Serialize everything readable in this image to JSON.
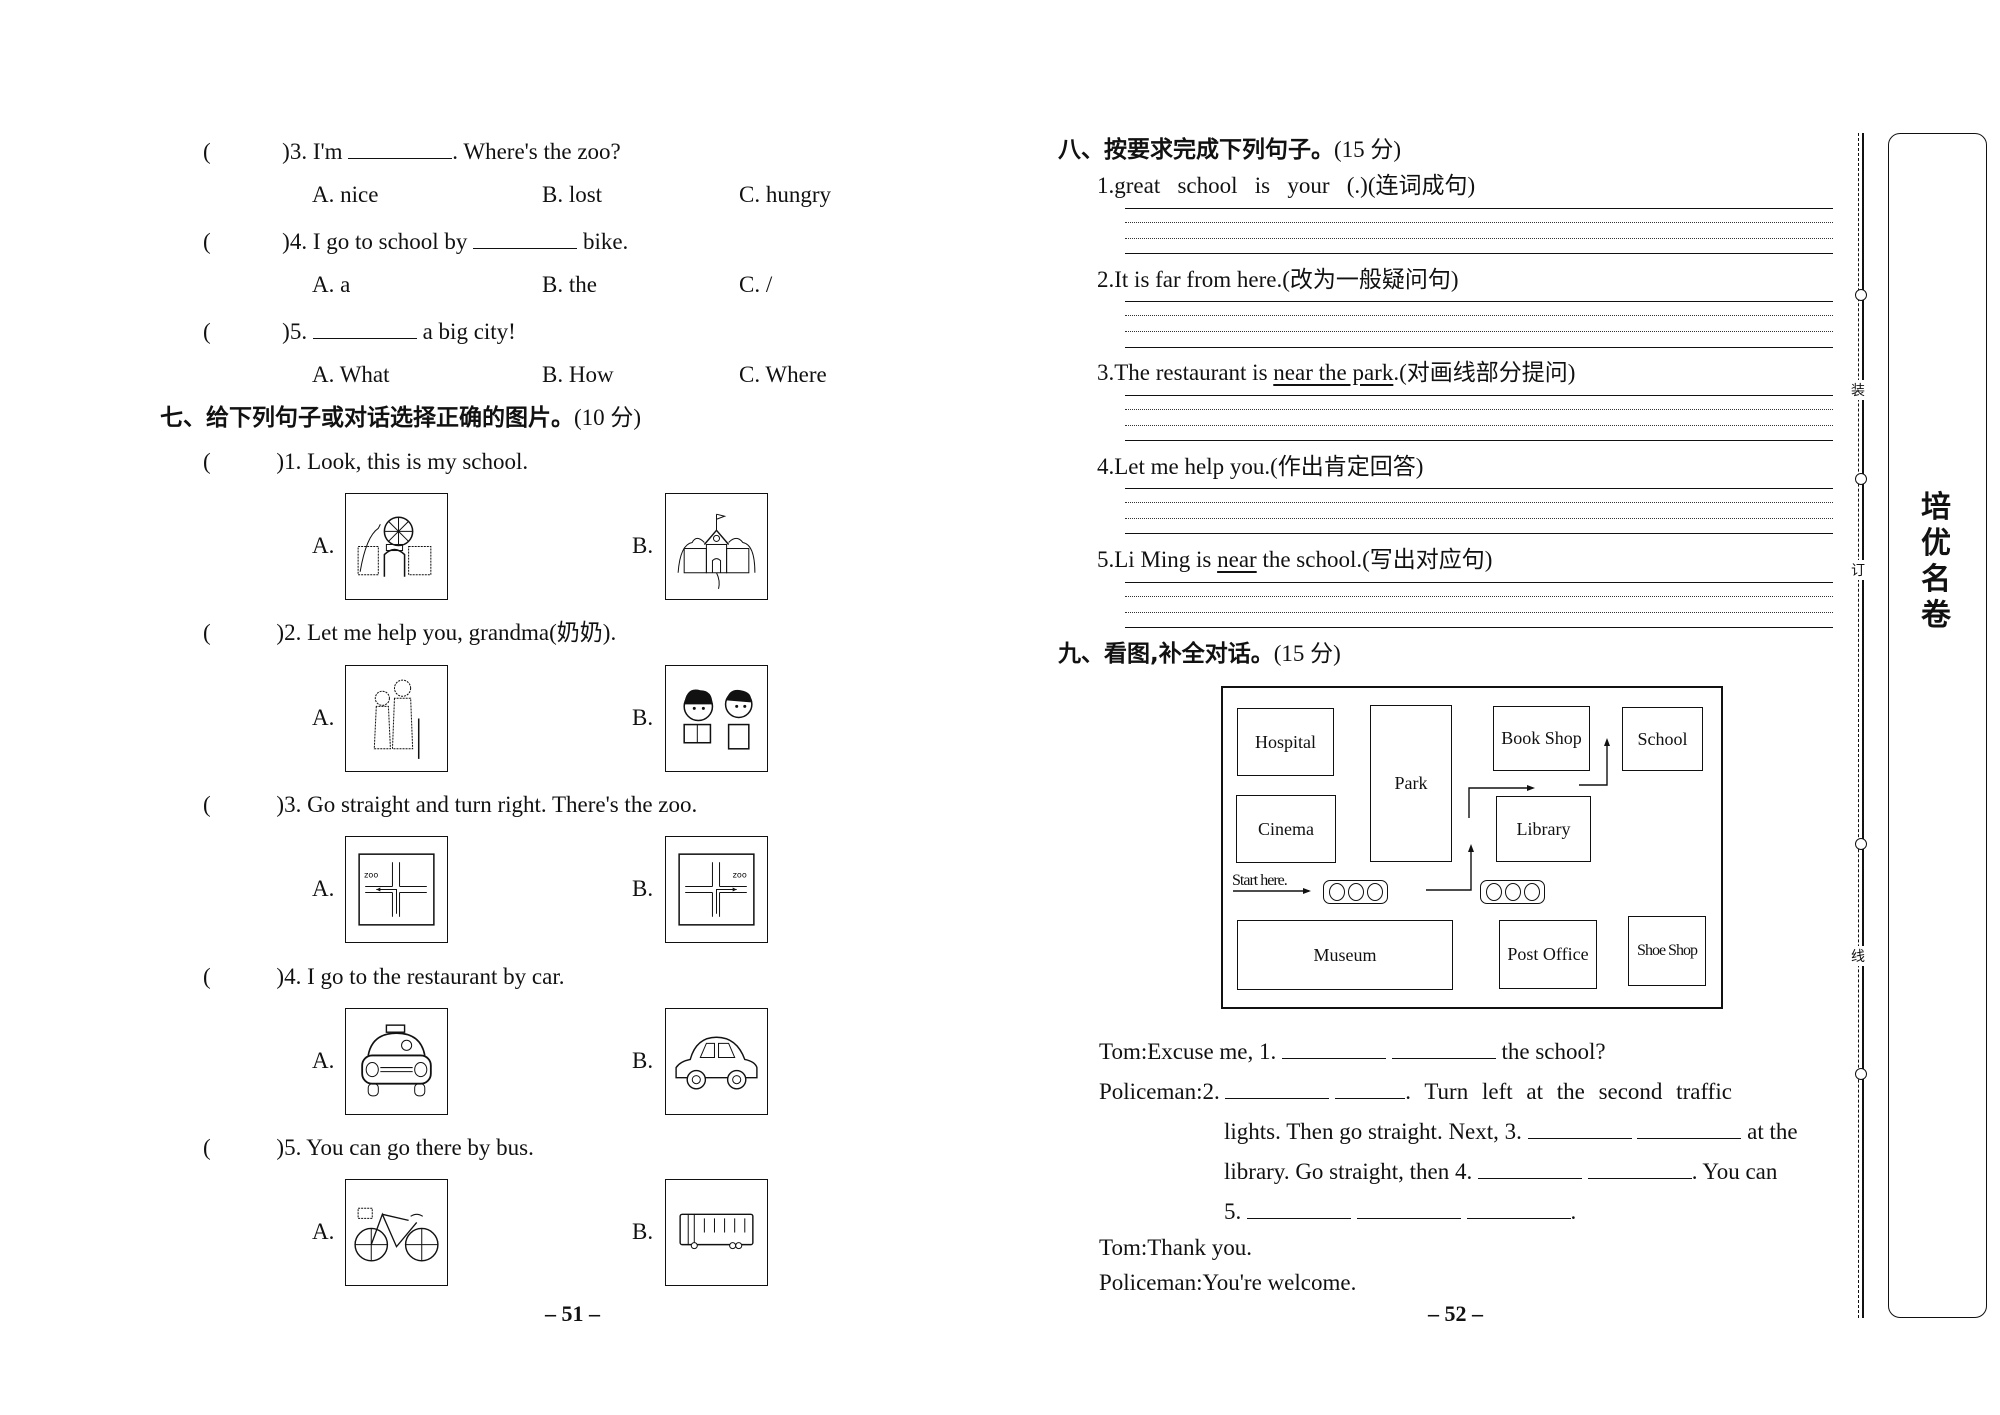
{
  "left_page": {
    "section6_items": [
      {
        "prefix": ")3. I'm",
        "suffix": ". Where's the zoo?",
        "options": [
          "A. nice",
          "B. lost",
          "C. hungry"
        ]
      },
      {
        "prefix": ")4. I go to school by",
        "suffix": "bike.",
        "options": [
          "A. a",
          "B. the",
          "C. /"
        ]
      },
      {
        "prefix": ")5.",
        "suffix": "a big city!",
        "options": [
          "A. What",
          "B. How",
          "C. Where"
        ]
      }
    ],
    "section7": {
      "title": "七、给下列句子或对话选择正确的图片。",
      "score": "(10 分)",
      "items": [
        {
          "text": ")1. Look, this is my school.",
          "option_a": "amusement-park-gate",
          "option_b": "school-building"
        },
        {
          "text": ")2. Let me help you, grandma(奶奶).",
          "option_a": "girl-helping-grandma",
          "option_b": "two-children-reading"
        },
        {
          "text": ")3. Go straight and turn right. There's the zoo.",
          "option_a": "crossroad-zoo-left",
          "option_b": "crossroad-zoo-right"
        },
        {
          "text": ")4. I go to the restaurant by car.",
          "option_a": "taxi",
          "option_b": "car"
        },
        {
          "text": ")5. You can go there by bus.",
          "option_a": "bike",
          "option_b": "bus"
        }
      ],
      "label_a": "A.",
      "label_b": "B.",
      "zoo_sign": "zoo"
    },
    "paren": "(",
    "page_number": "– 51 –"
  },
  "right_page": {
    "section8": {
      "title": "八、按要求完成下列句子。",
      "score": "(15 分)",
      "items": [
        {
          "num": "1.",
          "parts": [
            {
              "t": "great   school   is   your   (.)",
              "u": false
            },
            {
              "t": "(连词成句)",
              "u": false
            }
          ]
        },
        {
          "num": "2.",
          "parts": [
            {
              "t": "It is far from here.",
              "u": false
            },
            {
              "t": "(改为一般疑问句)",
              "u": false
            }
          ]
        },
        {
          "num": "3.",
          "parts": [
            {
              "t": "The restaurant is ",
              "u": false
            },
            {
              "t": "near the park",
              "u": true
            },
            {
              "t": ".(对画线部分提问)",
              "u": false
            }
          ]
        },
        {
          "num": "4.",
          "parts": [
            {
              "t": "Let me help you.",
              "u": false
            },
            {
              "t": "(作出肯定回答)",
              "u": false
            }
          ]
        },
        {
          "num": "5.",
          "parts": [
            {
              "t": "Li Ming is ",
              "u": false
            },
            {
              "t": "near",
              "u": true
            },
            {
              "t": " the school.(写出对应句)",
              "u": false
            }
          ]
        }
      ]
    },
    "section9": {
      "title": "九、看图,补全对话。",
      "score": "(15 分)",
      "map": {
        "buildings": [
          "Hospital",
          "Park",
          "Book Shop",
          "School",
          "Cinema",
          "Library",
          "Museum",
          "Post Office",
          "Shoe Shop"
        ],
        "start_label": "Start here."
      },
      "dialogue": {
        "l1_speaker": "Tom:",
        "l1_a": "Excuse me, 1.",
        "l1_b": "the school?",
        "l2_speaker": "Policeman:",
        "l2_a": "2.",
        "l2_b": ". Turn left at the second traffic",
        "l3_a": "lights. Then go straight. Next, 3.",
        "l3_b": "at the",
        "l4_a": "library. Go straight, then 4.",
        "l4_b": ". You can",
        "l5_a": "5.",
        "l5_b": ".",
        "l6_speaker": "Tom:",
        "l6_text": "Thank you.",
        "l7_speaker": "Policeman:",
        "l7_text": "You're welcome."
      }
    },
    "page_number": "– 52 –"
  },
  "binding_margin": {
    "cut_chars": [
      "装",
      "订",
      "线"
    ],
    "logo": [
      "培",
      "优",
      "名",
      "卷"
    ]
  }
}
